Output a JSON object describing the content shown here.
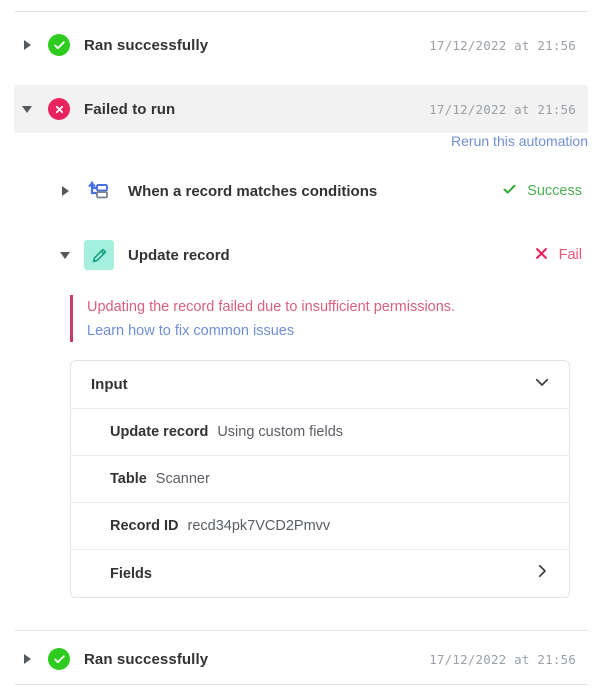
{
  "runs": [
    {
      "id": "run-success-top",
      "label": "Ran successfully",
      "timestamp": "17/12/2022 at 21:56",
      "status": "success",
      "expanded": false,
      "twisty_icon": "triangle-right-icon",
      "status_icon": "check-circle-icon"
    },
    {
      "id": "run-failed",
      "label": "Failed to run",
      "timestamp": "17/12/2022 at 21:56",
      "status": "failed",
      "expanded": true,
      "twisty_icon": "triangle-down-icon",
      "status_icon": "x-circle-icon"
    },
    {
      "id": "run-success-bottom",
      "label": "Ran successfully",
      "timestamp": "17/12/2022 at 21:56",
      "status": "success",
      "expanded": false,
      "twisty_icon": "triangle-right-icon",
      "status_icon": "check-circle-icon"
    }
  ],
  "detail": {
    "rerun_link": "Rerun this automation",
    "steps": [
      {
        "label": "When a record matches conditions",
        "status_text": "Success",
        "status_kind": "success",
        "status_icon": "check-mark-icon",
        "icon": "trigger-conditions-icon",
        "twisty_icon": "triangle-right-icon",
        "expanded": false
      },
      {
        "label": "Update record",
        "status_text": "Fail",
        "status_kind": "fail",
        "status_icon": "x-mark-icon",
        "icon": "pencil-icon",
        "twisty_icon": "triangle-down-icon",
        "expanded": true
      }
    ],
    "error": {
      "message": "Updating the record failed due to insufficient permissions.",
      "link": "Learn how to fix common issues"
    },
    "input_card": {
      "title": "Input",
      "collapse_icon": "chevron-down-icon",
      "rows": [
        {
          "key": "Update record",
          "value": "Using custom fields",
          "trailing_icon": ""
        },
        {
          "key": "Table",
          "value": "Scanner",
          "trailing_icon": ""
        },
        {
          "key": "Record ID",
          "value": "recd34pk7VCD2Pmvv",
          "trailing_icon": ""
        },
        {
          "key": "Fields",
          "value": "",
          "trailing_icon": "chevron-right-icon"
        }
      ]
    }
  },
  "colors": {
    "success_green": "#2ecc1e",
    "fail_pink": "#e8245e",
    "error_text": "#d9607f",
    "error_bar": "#c83a6a",
    "link_blue": "#6f8fd4",
    "selected_row_bg": "#f2f2f2",
    "pencil_icon_bg": "#a5f0dd",
    "trigger_icon_blue": "#4a6fe0"
  }
}
